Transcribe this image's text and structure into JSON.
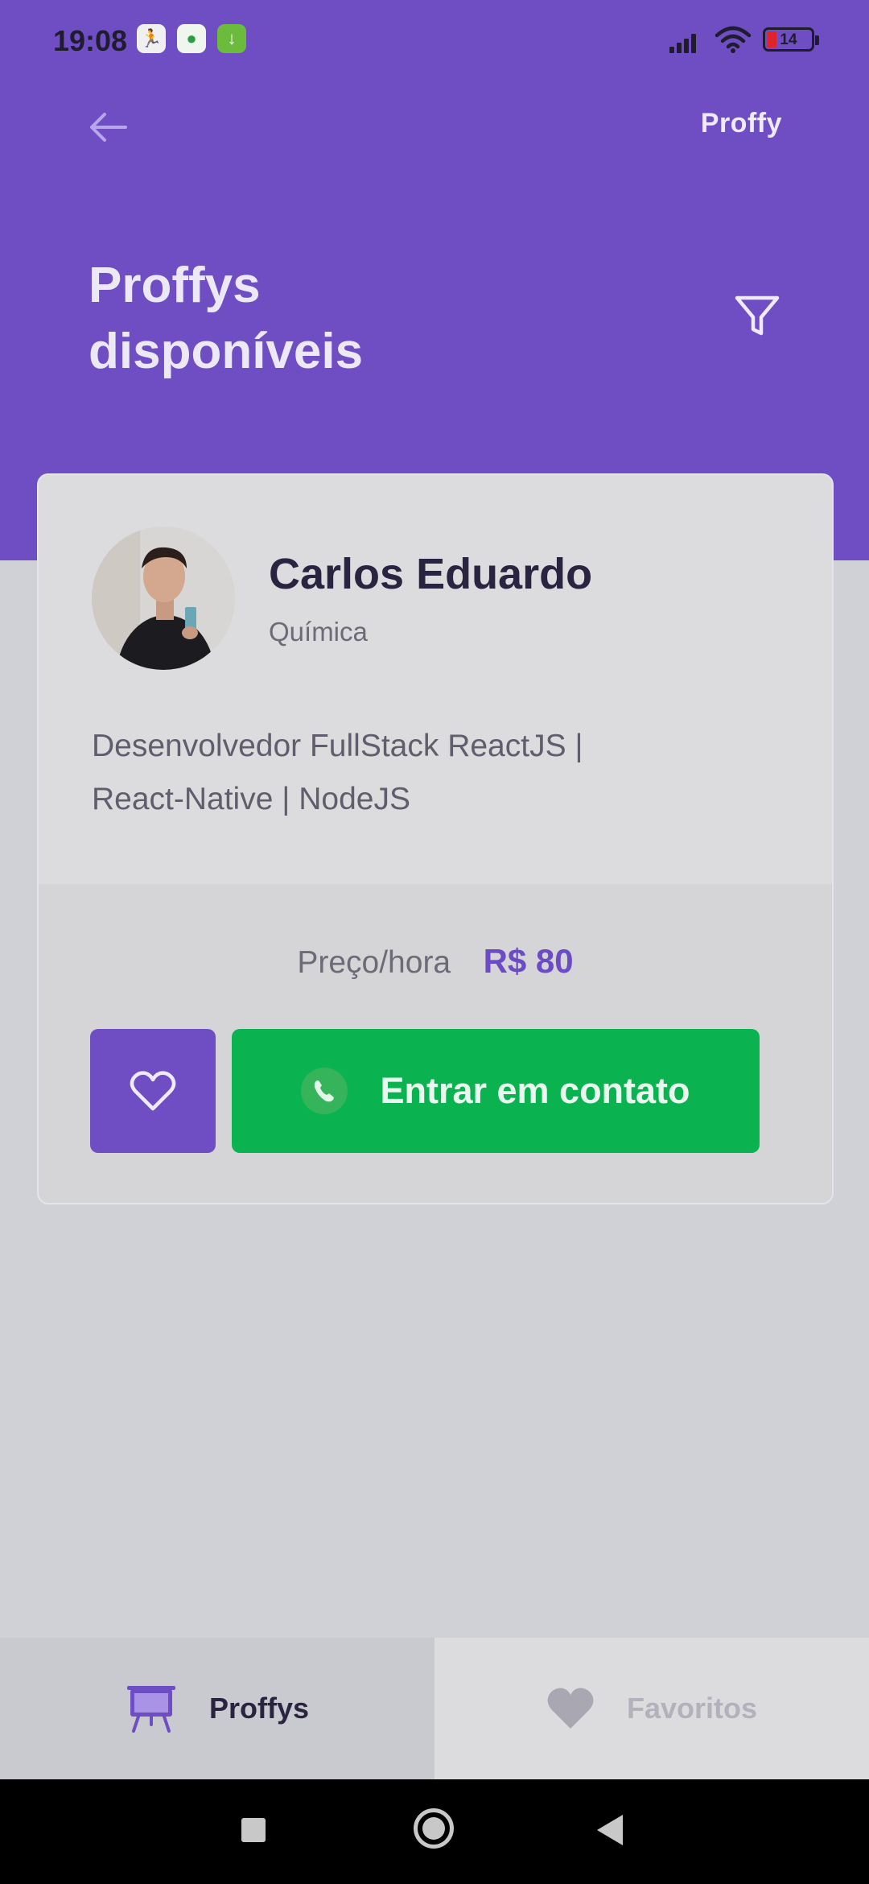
{
  "status_bar": {
    "time": "19:08",
    "battery_level": "14",
    "notification_icons": [
      "runner-app-icon",
      "android-app-icon",
      "download-icon"
    ]
  },
  "header": {
    "brand": "Proffy",
    "title_line1": "Proffys",
    "title_line2": "disponíveis"
  },
  "teacher_card": {
    "name": "Carlos Eduardo",
    "subject": "Química",
    "bio_line1": "Desenvolvedor FullStack ReactJS |",
    "bio_line2": "React-Native | NodeJS",
    "price_label": "Preço/hora",
    "price_value": "R$ 80",
    "contact_label": "Entrar em contato"
  },
  "tab_bar": {
    "tabs": [
      {
        "label": "Proffys",
        "active": true,
        "icon": "easel-icon"
      },
      {
        "label": "Favoritos",
        "active": false,
        "icon": "heart-icon"
      }
    ]
  },
  "colors": {
    "primary": "#6f4ec4",
    "background": "#d0d0d7",
    "card": "#dcdcde",
    "contact_green": "#0ab34f",
    "text_dark": "#2a2440",
    "text_muted": "#6e6a78"
  }
}
